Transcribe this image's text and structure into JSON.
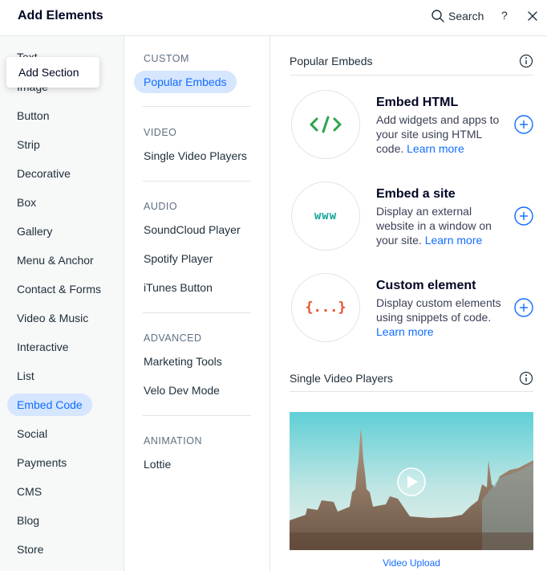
{
  "header": {
    "title": "Add Elements",
    "search_label": "Search",
    "help_label": "?"
  },
  "tooltip": "Add Section",
  "categories": [
    "Text",
    "Image",
    "Button",
    "Strip",
    "Decorative",
    "Box",
    "Gallery",
    "Menu & Anchor",
    "Contact & Forms",
    "Video & Music",
    "Interactive",
    "List",
    "Embed Code",
    "Social",
    "Payments",
    "CMS",
    "Blog",
    "Store"
  ],
  "selected_category": "Embed Code",
  "subnav": {
    "custom": {
      "heading": "CUSTOM",
      "items": [
        "Popular Embeds"
      ]
    },
    "video": {
      "heading": "VIDEO",
      "items": [
        "Single Video Players"
      ]
    },
    "audio": {
      "heading": "AUDIO",
      "items": [
        "SoundCloud Player",
        "Spotify Player",
        "iTunes Button"
      ]
    },
    "advanced": {
      "heading": "ADVANCED",
      "items": [
        "Marketing Tools",
        "Velo Dev Mode"
      ]
    },
    "animation": {
      "heading": "ANIMATION",
      "items": [
        "Lottie"
      ]
    }
  },
  "selected_subnav": "Popular Embeds",
  "popular": {
    "heading": "Popular Embeds",
    "items": [
      {
        "icon": "code-brackets-icon",
        "glyph": "</>",
        "color": "#2ea34a",
        "title": "Embed HTML",
        "desc": "Add widgets and apps to your site using HTML code.",
        "link": "Learn more"
      },
      {
        "icon": "www-icon",
        "glyph": "www",
        "color": "#15a59a",
        "title": "Embed a site",
        "desc": "Display an external website in a window on your site.",
        "link": "Learn more"
      },
      {
        "icon": "curly-braces-icon",
        "glyph": "{...}",
        "color": "#e8502d",
        "title": "Custom element",
        "desc": "Display custom elements using snippets of code.",
        "link": "Learn more"
      }
    ]
  },
  "video_section": {
    "heading": "Single Video Players",
    "caption": "Video Upload"
  },
  "colors": {
    "accent": "#116dff",
    "selected_bg": "#d6e6fe",
    "border": "#dfe5eb"
  }
}
